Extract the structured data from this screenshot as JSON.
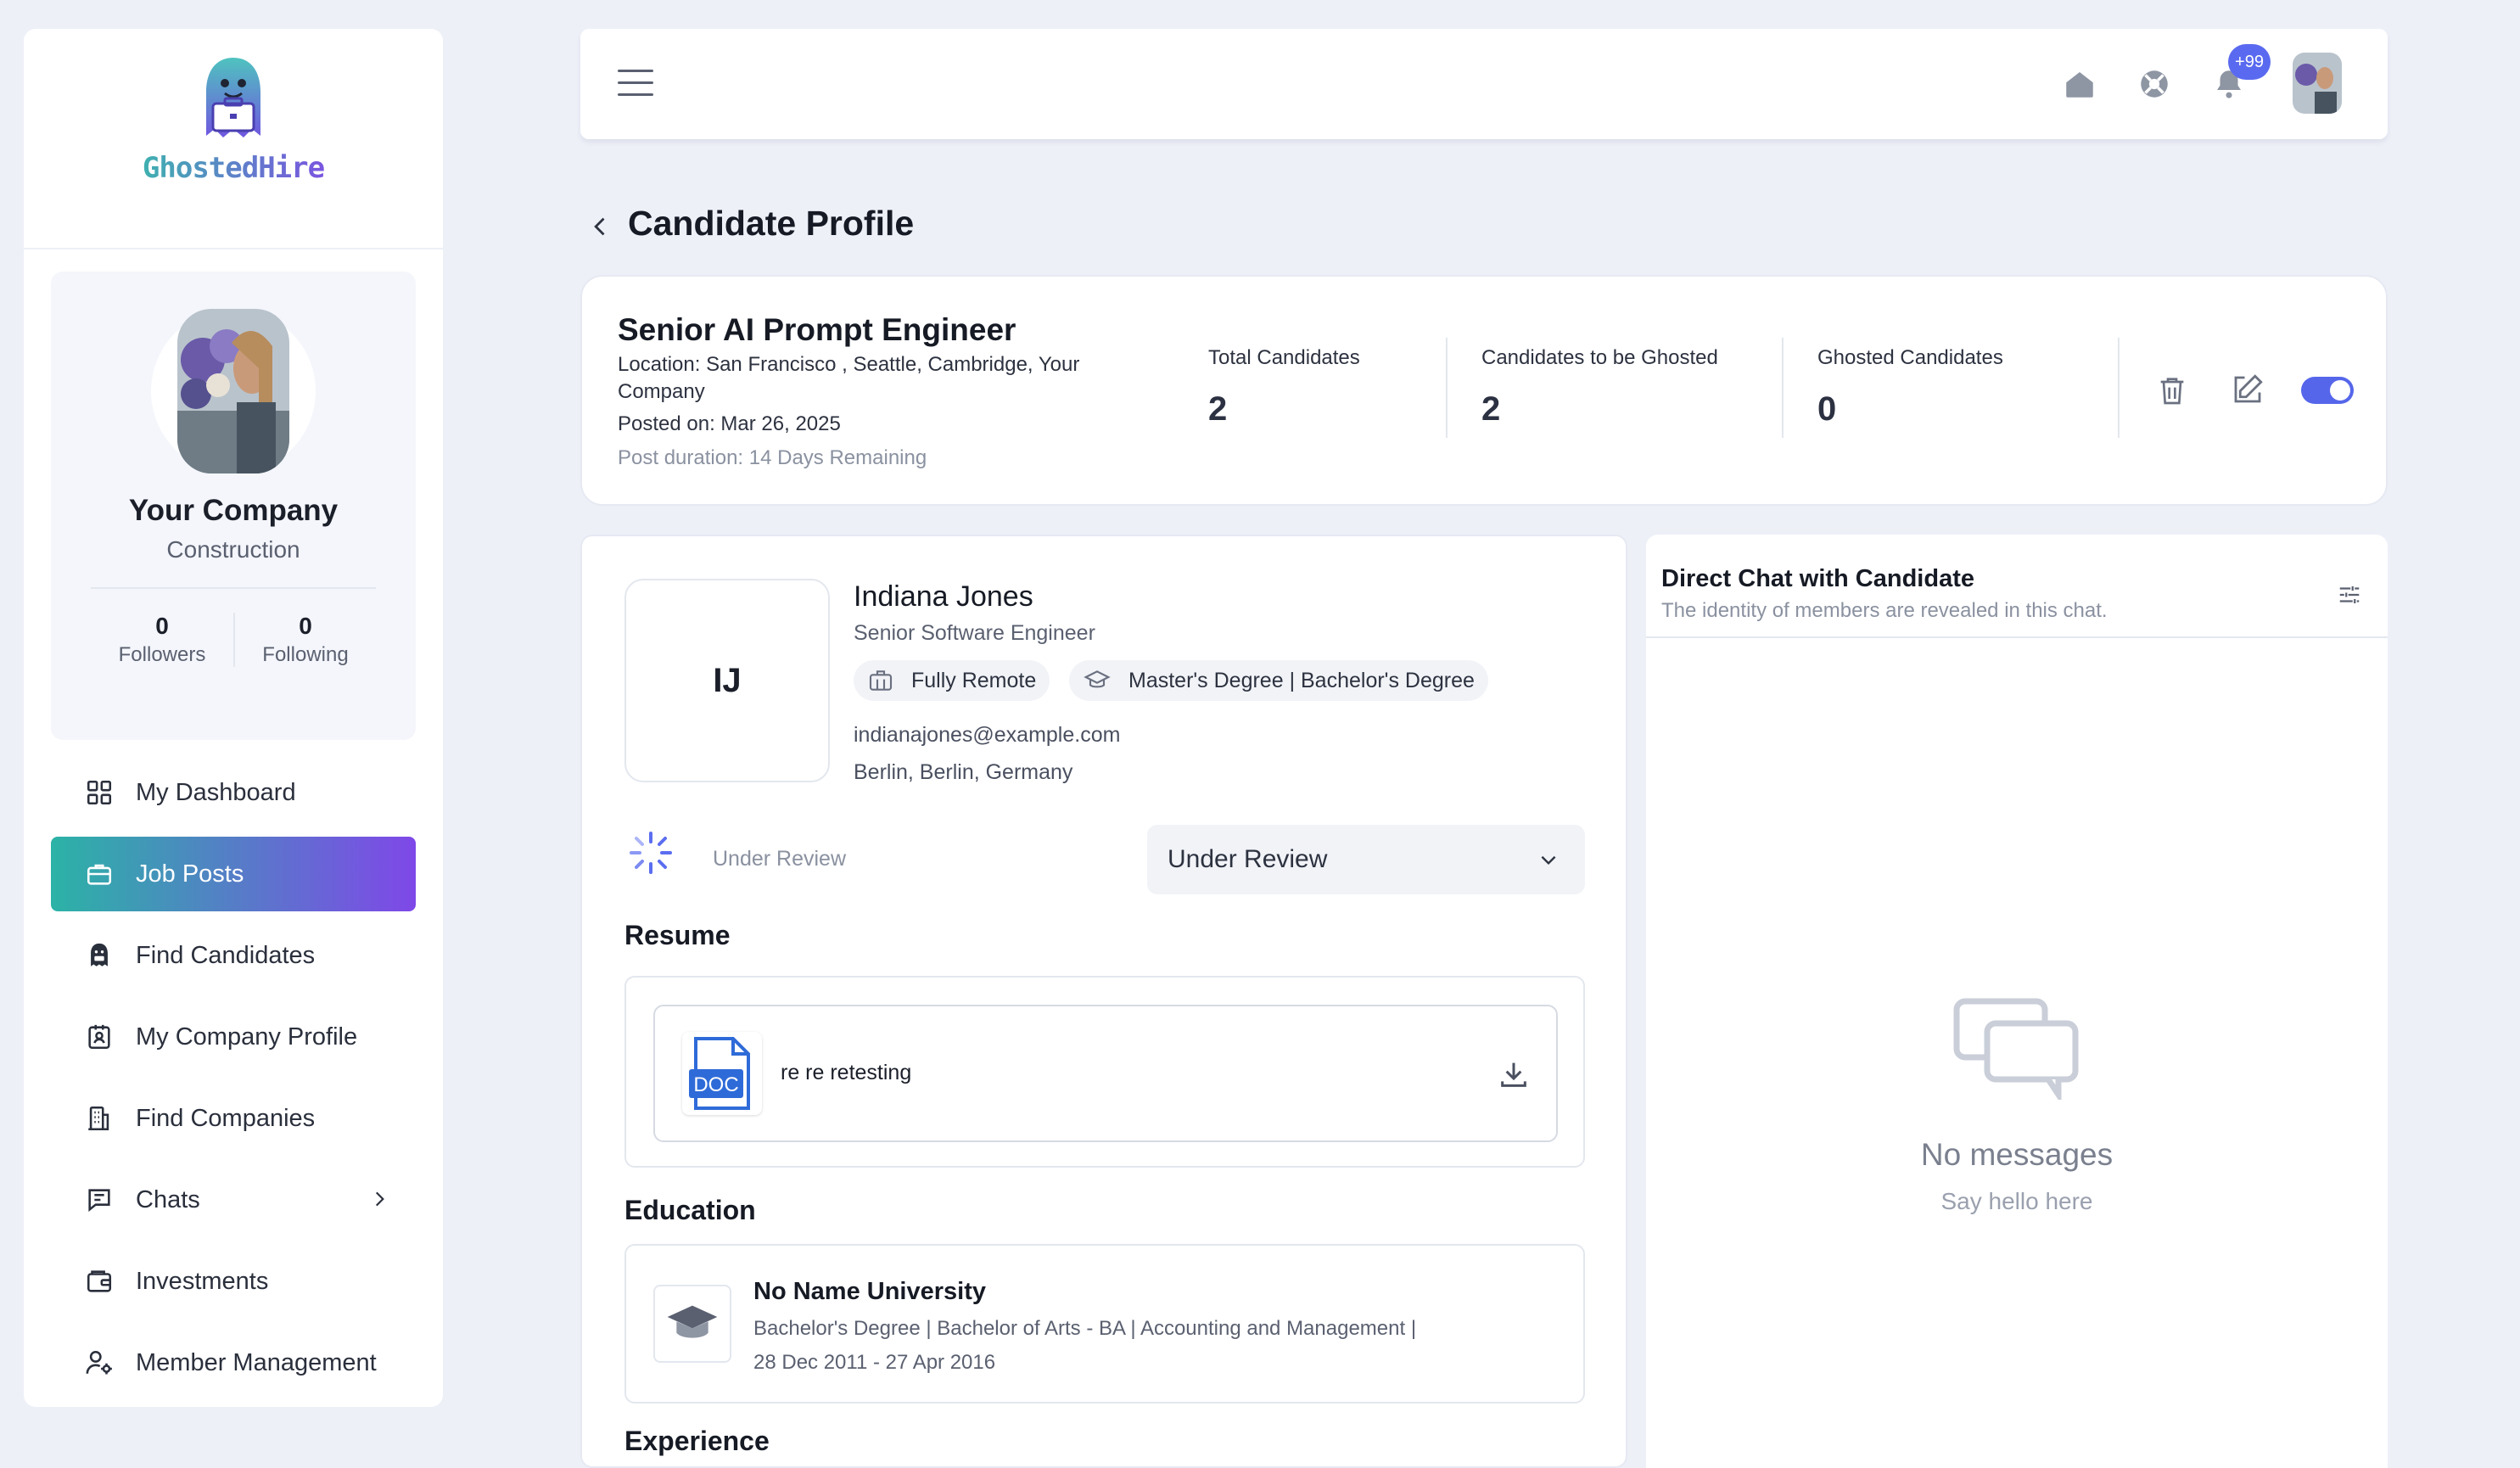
{
  "brand": {
    "name": "GhostedHire"
  },
  "company": {
    "name": "Your Company",
    "category": "Construction",
    "followers": "0",
    "followers_label": "Followers",
    "following": "0",
    "following_label": "Following"
  },
  "nav": [
    {
      "label": "My Dashboard",
      "icon": "grid-icon"
    },
    {
      "label": "Job Posts",
      "icon": "briefcase-icon",
      "active": true
    },
    {
      "label": "Find Candidates",
      "icon": "ghost-icon"
    },
    {
      "label": "My Company Profile",
      "icon": "id-card-icon"
    },
    {
      "label": "Find Companies",
      "icon": "building-icon"
    },
    {
      "label": "Chats",
      "icon": "chat-icon"
    },
    {
      "label": "Investments",
      "icon": "wallet-icon"
    },
    {
      "label": "Member Management",
      "icon": "user-gear-icon"
    }
  ],
  "topbar": {
    "notification_count": "+99"
  },
  "page": {
    "title": "Candidate Profile"
  },
  "job": {
    "title": "Senior AI Prompt Engineer",
    "location": "Location: San Francisco , Seattle, Cambridge, Your Company",
    "posted": "Posted on: Mar 26, 2025",
    "duration_label": "Post duration:",
    "duration_value": "14 Days Remaining",
    "metrics": [
      {
        "label": "Total Candidates",
        "value": "2"
      },
      {
        "label": "Candidates to be Ghosted",
        "value": "2"
      },
      {
        "label": "Ghosted Candidates",
        "value": "0"
      }
    ],
    "active": true
  },
  "candidate": {
    "initials": "IJ",
    "name": "Indiana Jones",
    "role": "Senior Software Engineer",
    "work_mode": "Fully Remote",
    "education_level": "Master's Degree | Bachelor's Degree",
    "email": "indianajones@example.com",
    "location": "Berlin, Berlin, Germany",
    "status": "Under Review",
    "status_selected": "Under Review"
  },
  "resume": {
    "title": "Resume",
    "file_name": "re re retesting",
    "file_type": "DOC"
  },
  "education": {
    "title": "Education",
    "school": "No Name University",
    "degree": "Bachelor's Degree | Bachelor of Arts - BA | Accounting and Management |",
    "dates": "28 Dec 2011 - 27 Apr 2016"
  },
  "experience": {
    "title": "Experience"
  },
  "chat": {
    "title": "Direct Chat with Candidate",
    "subtitle": "The identity of members are revealed in this chat.",
    "empty_title": "No messages",
    "empty_sub": "Say hello here"
  }
}
